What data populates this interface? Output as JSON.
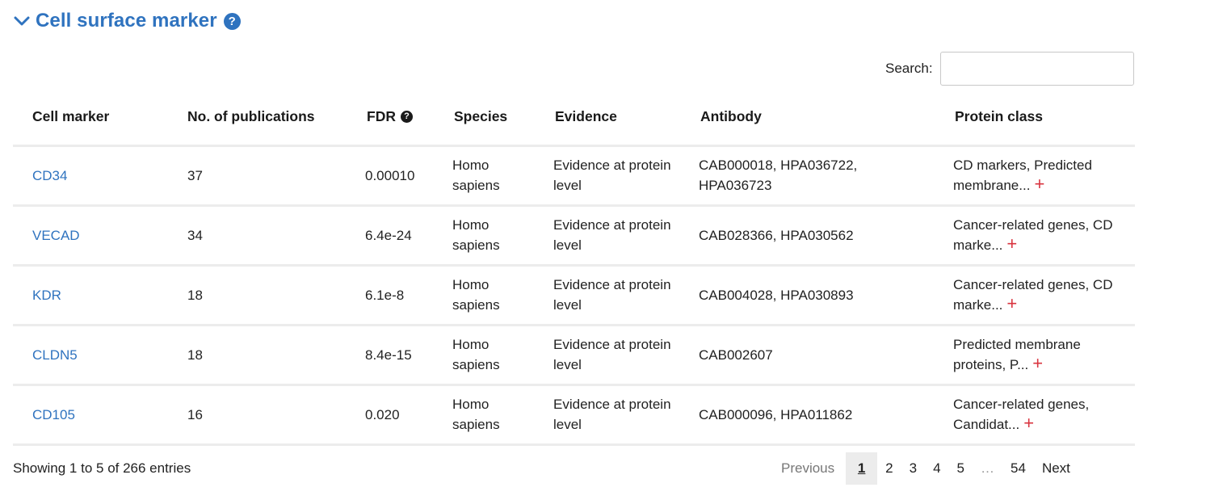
{
  "section": {
    "title": "Cell surface marker",
    "help": "?"
  },
  "search": {
    "label": "Search:",
    "value": "",
    "placeholder": ""
  },
  "table": {
    "headers": [
      "Cell marker",
      "No. of publications",
      "FDR",
      "Species",
      "Evidence",
      "Antibody",
      "Protein class"
    ],
    "fdr_help": "?",
    "rows": [
      {
        "marker": "CD34",
        "pubs": "37",
        "fdr": "0.00010",
        "species": "Homo sapiens",
        "evidence": "Evidence at protein level",
        "antibody": "CAB000018, HPA036722, HPA036723",
        "protein_class": "CD markers, Predicted membrane...",
        "expand": "+"
      },
      {
        "marker": "VECAD",
        "pubs": "34",
        "fdr": "6.4e-24",
        "species": "Homo sapiens",
        "evidence": "Evidence at protein level",
        "antibody": "CAB028366, HPA030562",
        "protein_class": "Cancer-related genes, CD marke...",
        "expand": "+"
      },
      {
        "marker": "KDR",
        "pubs": "18",
        "fdr": "6.1e-8",
        "species": "Homo sapiens",
        "evidence": "Evidence at protein level",
        "antibody": "CAB004028, HPA030893",
        "protein_class": "Cancer-related genes, CD marke...",
        "expand": "+"
      },
      {
        "marker": "CLDN5",
        "pubs": "18",
        "fdr": "8.4e-15",
        "species": "Homo sapiens",
        "evidence": "Evidence at protein level",
        "antibody": "CAB002607",
        "protein_class": "Predicted membrane proteins, P...",
        "expand": "+"
      },
      {
        "marker": "CD105",
        "pubs": "16",
        "fdr": "0.020",
        "species": "Homo sapiens",
        "evidence": "Evidence at protein level",
        "antibody": "CAB000096, HPA011862",
        "protein_class": "Cancer-related genes, Candidat...",
        "expand": "+"
      }
    ]
  },
  "footer": {
    "info": "Showing 1 to 5 of 266 entries"
  },
  "pagination": {
    "previous": "Previous",
    "pages": [
      "1",
      "2",
      "3",
      "4",
      "5"
    ],
    "ellipsis": "…",
    "last": "54",
    "next": "Next",
    "current": "1"
  },
  "colors": {
    "link": "#2f73bf",
    "expand": "#d9343f",
    "row_border": "#ececec"
  },
  "icons": {
    "collapse": "chevron-down-icon",
    "help": "question-circle-icon",
    "expand": "plus-icon"
  }
}
